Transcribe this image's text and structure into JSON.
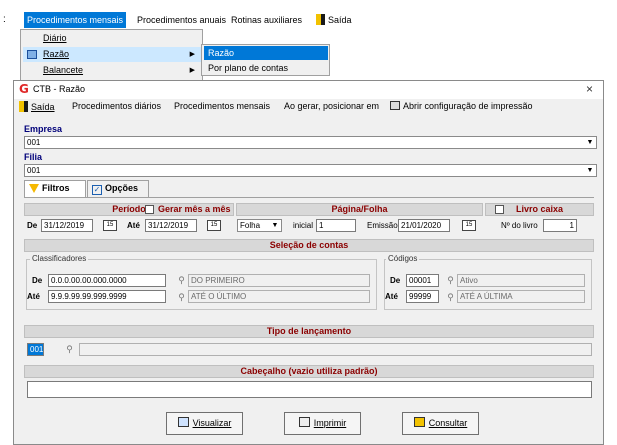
{
  "menubar": {
    "items": [
      {
        "label": "Procedimentos mensais",
        "underline": "m"
      },
      {
        "label": "Procedimentos anuais"
      },
      {
        "label": "Rotinas auxiliares"
      },
      {
        "label": "Saída"
      }
    ]
  },
  "dropdown": {
    "items": [
      "Diário",
      "Razão",
      "Balancete"
    ]
  },
  "submenu": {
    "items": [
      "Razão",
      "Por plano de contas"
    ]
  },
  "window": {
    "title": "CTB - Razão",
    "close": "×",
    "toolbar": {
      "exit": "Saída",
      "daily": "Procedimentos diários",
      "monthly": "Procedimentos mensais",
      "on_generate": "Ao gerar, posicionar em",
      "print_config": "Abrir configuração de impressão"
    },
    "empresa_label": "Empresa",
    "empresa_value": "001",
    "filial_label": "Filia",
    "filial_value": "001",
    "tabs": [
      "Filtros",
      "Opções"
    ],
    "periodo": {
      "header": "Período",
      "month_check": "Gerar mês a mês",
      "from_label": "De",
      "from_value": "31/12/2019",
      "to_label": "Até",
      "to_value": "31/12/2019"
    },
    "pagina": {
      "header": "Página/Folha",
      "mode": "Folha",
      "initial_label": "inicial",
      "initial_value": "1",
      "emission_label": "Emissão",
      "emission_value": "21/01/2020"
    },
    "livro": {
      "header": "Livro caixa",
      "num_label": "Nº do livro",
      "num_value": "1"
    },
    "selecao": {
      "header": "Seleção de contas",
      "classif_legend": "Classificadores",
      "from_label": "De",
      "from_code": "0.0.0.00.00.000.0000",
      "from_desc": "DO PRIMEIRO",
      "to_label": "Até",
      "to_code": "9.9.9.99.99.999.9999",
      "to_desc": "ATÉ O ÚLTIMO",
      "codes_legend": "Códigos",
      "code_from_label": "De",
      "code_from": "00001",
      "code_from_desc": "Ativo",
      "code_to_label": "Até",
      "code_to": "99999",
      "code_to_desc": "ATÉ A ÚLTIMA"
    },
    "lancamento": {
      "header": "Tipo de lançamento",
      "code": "001",
      "desc": ""
    },
    "cabecalho": {
      "header": "Cabeçalho (vazio utiliza padrão)",
      "value": ""
    },
    "buttons": {
      "view": "Visualizar",
      "print": "Imprimir",
      "query": "Consultar"
    }
  }
}
